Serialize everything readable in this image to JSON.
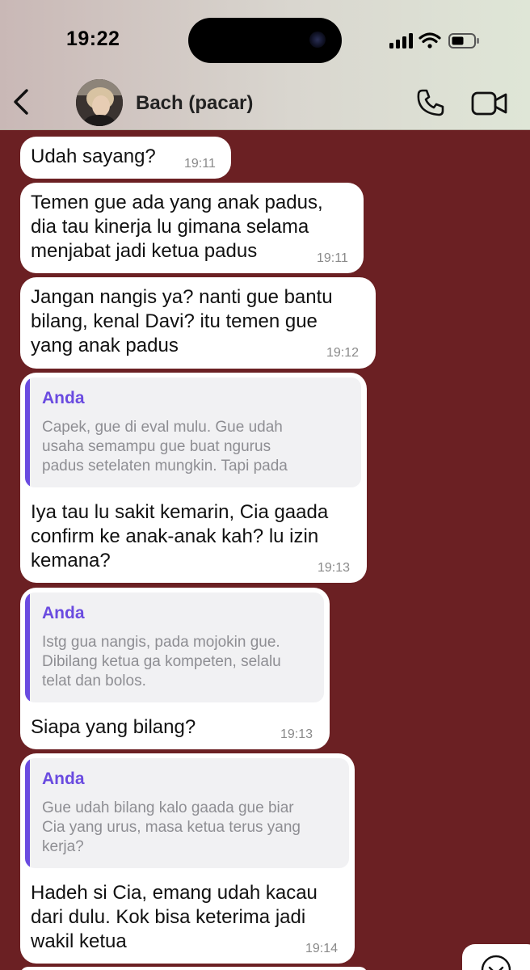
{
  "status_bar": {
    "time": "19:22"
  },
  "header": {
    "contact_name": "Bach (pacar)"
  },
  "messages": [
    {
      "text": "Udah sayang?",
      "time": "19:11"
    },
    {
      "text": "Temen gue ada yang anak padus,\ndia tau kinerja lu gimana selama\nmenjabat jadi ketua padus",
      "time": "19:11"
    },
    {
      "text": "Jangan nangis ya? nanti gue bantu\nbilang, kenal Davi? itu temen gue\nyang anak padus",
      "time": "19:12"
    },
    {
      "quote_name": "Anda",
      "quote_text": "Capek, gue di eval mulu. Gue udah\nusaha semampu gue buat ngurus\npadus setelaten mungkin. Tapi pada",
      "text": "Iya tau lu sakit kemarin, Cia gaada\nconfirm ke anak-anak kah? lu izin\nkemana?",
      "time": "19:13"
    },
    {
      "quote_name": "Anda",
      "quote_text": "Istg gua nangis, pada mojokin gue.\nDibilang ketua ga kompeten, selalu\ntelat dan bolos.",
      "text": "Siapa yang bilang?",
      "time": "19:13"
    },
    {
      "quote_name": "Anda",
      "quote_text": "Gue udah bilang kalo gaada gue biar\nCia yang urus, masa ketua terus yang\nkerja?",
      "text": "Hadeh si Cia, emang udah kacau\ndari dulu. Kok bisa keterima jadi\nwakil ketua",
      "time": "19:14"
    }
  ],
  "colors": {
    "chat_background": "#6b2023",
    "bubble": "#ffffff",
    "quote_accent": "#6a4be0",
    "quote_background": "#f1f1f3"
  },
  "icons": [
    "back-chevron-icon",
    "phone-icon",
    "video-camera-icon",
    "signal-icon",
    "wifi-icon",
    "battery-icon",
    "chevron-down-icon"
  ]
}
